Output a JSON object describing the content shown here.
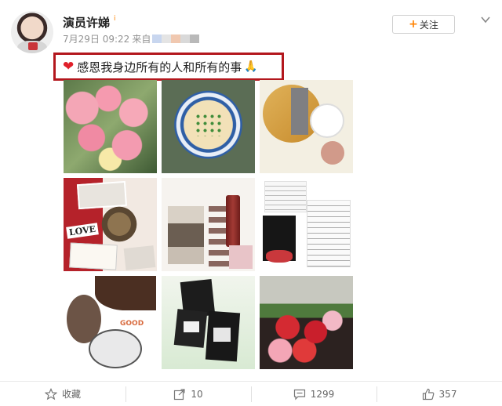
{
  "user": {
    "name": "演员许娣",
    "verified_mark": "i",
    "date": "7月29日 09:22",
    "source_prefix": "来自"
  },
  "follow": {
    "label": "关注",
    "plus": "+"
  },
  "post": {
    "text": "感恩我身边所有的人和所有的事",
    "emoji_heart": "❤",
    "emoji_hands": "🙏"
  },
  "actions": {
    "favorite": {
      "label": "收藏",
      "icon": "star-icon"
    },
    "repost": {
      "label": "10",
      "icon": "share-icon"
    },
    "comment": {
      "label": "1299",
      "icon": "comment-icon"
    },
    "like": {
      "label": "357",
      "icon": "thumb-up-icon"
    }
  },
  "photos": {
    "p4_text": "LOVE",
    "p7_text": "GOOD"
  },
  "colors": {
    "accent": "#ff8200",
    "highlight_border": "#b3171d"
  }
}
